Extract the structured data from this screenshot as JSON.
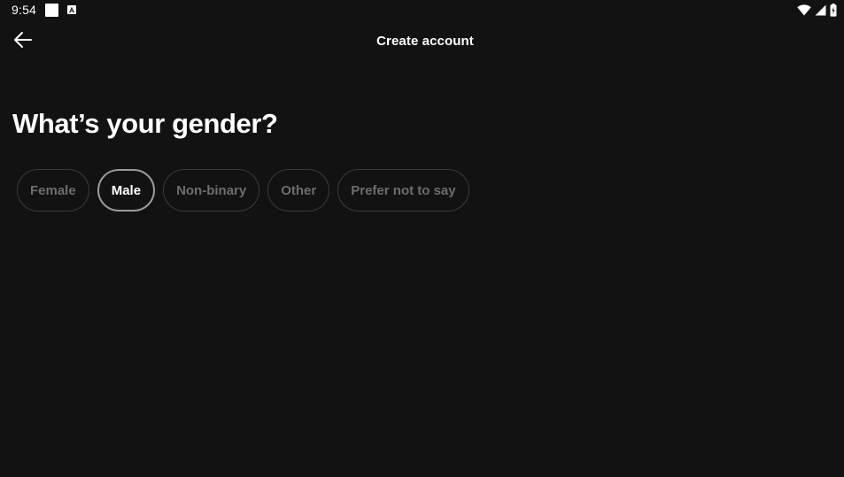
{
  "status_bar": {
    "time": "9:54"
  },
  "header": {
    "title": "Create account"
  },
  "question": "What’s your gender?",
  "options": [
    {
      "label": "Female",
      "selected": false
    },
    {
      "label": "Male",
      "selected": true
    },
    {
      "label": "Non-binary",
      "selected": false
    },
    {
      "label": "Other",
      "selected": false
    },
    {
      "label": "Prefer not to say",
      "selected": false
    }
  ],
  "colors": {
    "background": "#121212",
    "text_primary": "#ffffff",
    "chip_border": "#3a3a3a",
    "chip_selected_border": "#9a9a9a",
    "chip_text_muted": "#6d6d6d"
  }
}
